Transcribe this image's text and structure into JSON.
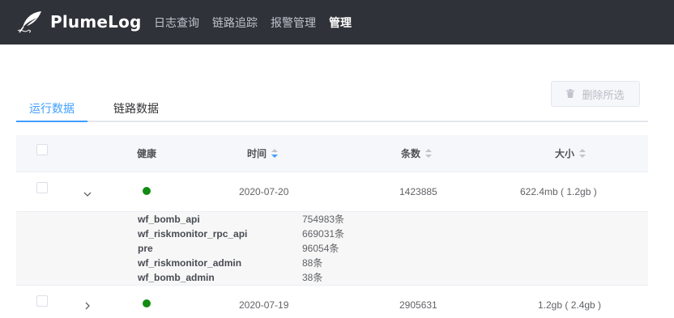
{
  "app": {
    "name": "PlumeLog"
  },
  "nav": {
    "items": [
      {
        "label": "日志查询",
        "active": false
      },
      {
        "label": "链路追踪",
        "active": false
      },
      {
        "label": "报警管理",
        "active": false
      },
      {
        "label": "管理",
        "active": true
      }
    ]
  },
  "toolbar": {
    "delete_label": "删除所选",
    "delete_disabled": true
  },
  "tabs": [
    {
      "label": "运行数据",
      "active": true
    },
    {
      "label": "链路数据",
      "active": false
    }
  ],
  "table": {
    "columns": {
      "health": "健康",
      "time": "时间",
      "count": "条数",
      "size": "大小"
    },
    "sort": {
      "column": "time",
      "order": "descending"
    },
    "rows": [
      {
        "health": "green",
        "date": "2020-07-20",
        "count": "1423885",
        "size": "622.4mb ( 1.2gb )",
        "expanded": true,
        "details": [
          {
            "name": "wf_bomb_api",
            "count": "754983条"
          },
          {
            "name": "wf_riskmonitor_rpc_api",
            "count": "669031条"
          },
          {
            "name": "pre",
            "count": "96054条"
          },
          {
            "name": "wf_riskmonitor_admin",
            "count": "88条"
          },
          {
            "name": "wf_bomb_admin",
            "count": "38条"
          }
        ]
      },
      {
        "health": "green",
        "date": "2020-07-19",
        "count": "2905631",
        "size": "1.2gb ( 2.4gb )",
        "expanded": false
      }
    ]
  },
  "colors": {
    "navbar": "#2f3238",
    "accent": "#409eff",
    "health_green": "#118b11"
  }
}
